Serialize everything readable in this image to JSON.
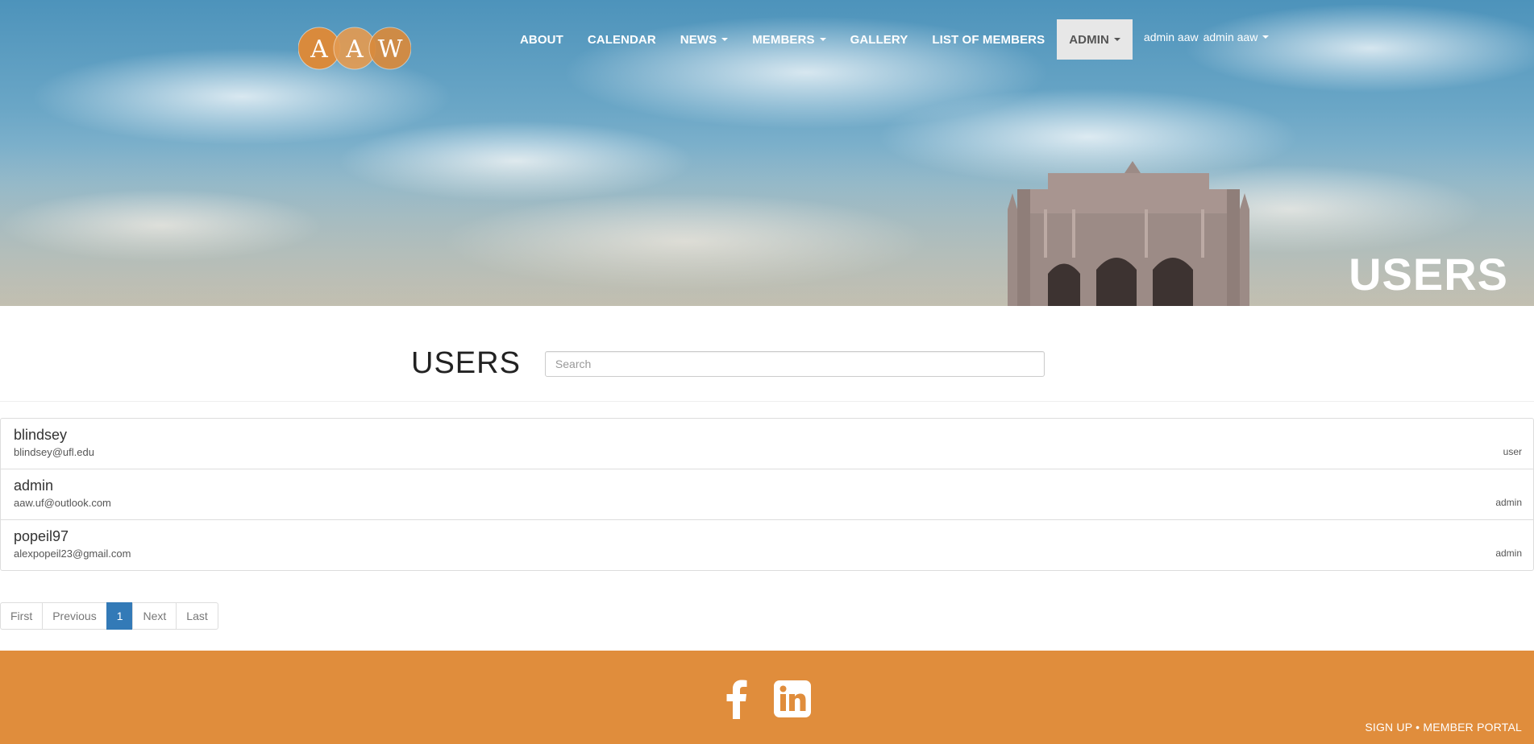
{
  "logo": {
    "letters": [
      "A",
      "A",
      "W"
    ]
  },
  "nav": {
    "items": [
      {
        "label": "ABOUT",
        "dropdown": false
      },
      {
        "label": "CALENDAR",
        "dropdown": false
      },
      {
        "label": "NEWS",
        "dropdown": true
      },
      {
        "label": "MEMBERS",
        "dropdown": true
      },
      {
        "label": "GALLERY",
        "dropdown": false
      },
      {
        "label": "LIST OF MEMBERS",
        "dropdown": false
      },
      {
        "label": "ADMIN",
        "dropdown": true,
        "active": true
      }
    ],
    "user_name": "admin aaw",
    "user_menu": "admin aaw"
  },
  "hero": {
    "title": "USERS"
  },
  "users": {
    "heading": "USERS",
    "search_placeholder": "Search",
    "rows": [
      {
        "username": "blindsey",
        "email": "blindsey@ufl.edu",
        "role": "user"
      },
      {
        "username": "admin",
        "email": "aaw.uf@outlook.com",
        "role": "admin"
      },
      {
        "username": "popeil97",
        "email": "alexpopeil23@gmail.com",
        "role": "admin"
      }
    ]
  },
  "pagination": {
    "first": "First",
    "previous": "Previous",
    "current": "1",
    "next": "Next",
    "last": "Last"
  },
  "footer": {
    "icons": [
      "facebook-icon",
      "linkedin-icon"
    ],
    "sign_up": "SIGN UP",
    "separator": "•",
    "member_portal": "MEMBER PORTAL"
  },
  "colors": {
    "accent": "#e08d3c",
    "primary": "#337ab7",
    "logo_circle": "#d98a3c"
  }
}
